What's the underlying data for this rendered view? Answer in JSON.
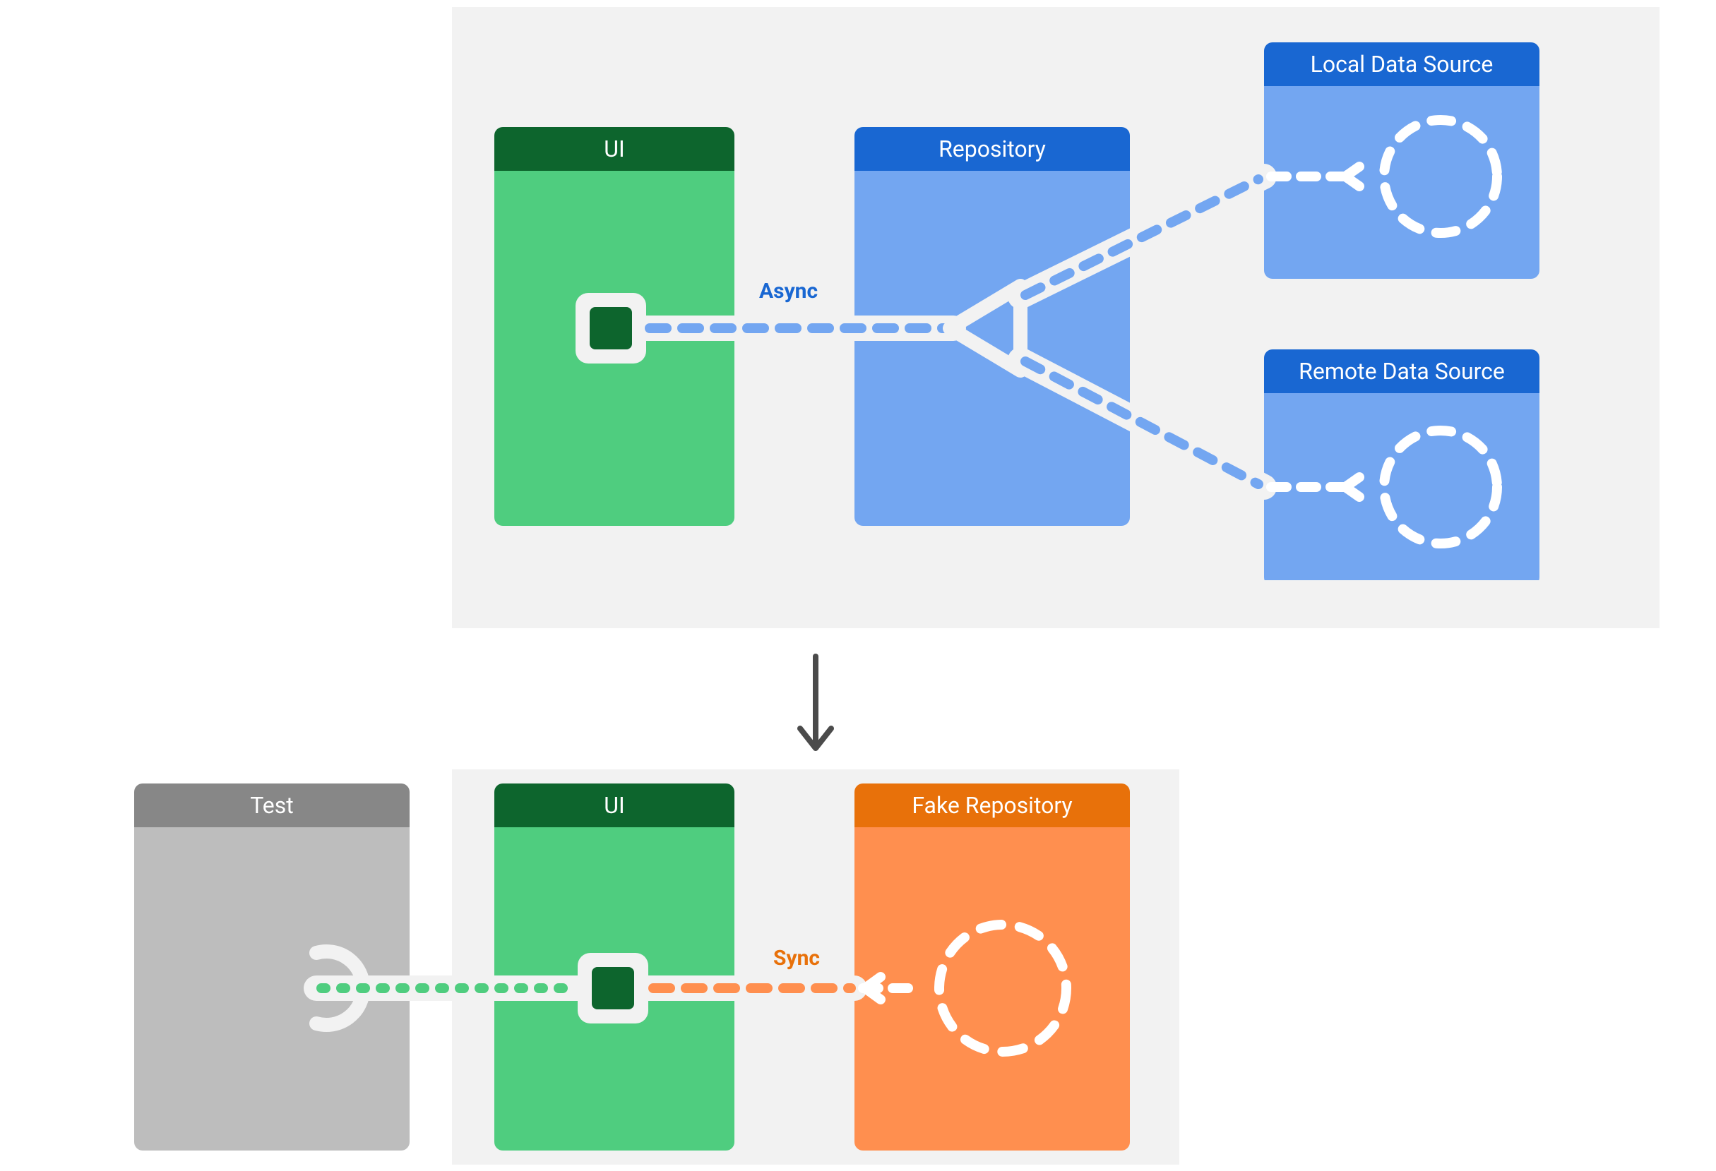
{
  "diagram": {
    "top": {
      "ui": "UI",
      "repo": "Repository",
      "local": "Local Data Source",
      "remote": "Remote Data Source",
      "edge_label": "Async"
    },
    "bottom": {
      "test": "Test",
      "ui": "UI",
      "fake_repo": "Fake Repository",
      "edge_label": "Sync"
    }
  },
  "colors": {
    "green_dark": "#0d652d",
    "green_light": "#4fcd7f",
    "blue_dark": "#1967d2",
    "blue_light": "#73a6f1",
    "orange_dark": "#e8710a",
    "orange_light": "#ff8f4f",
    "gray_dark": "#878787",
    "gray_light": "#bdbdbd",
    "panel": "#f2f2f2",
    "arrow": "#4b4b4b",
    "edge_white": "#ffffff"
  }
}
